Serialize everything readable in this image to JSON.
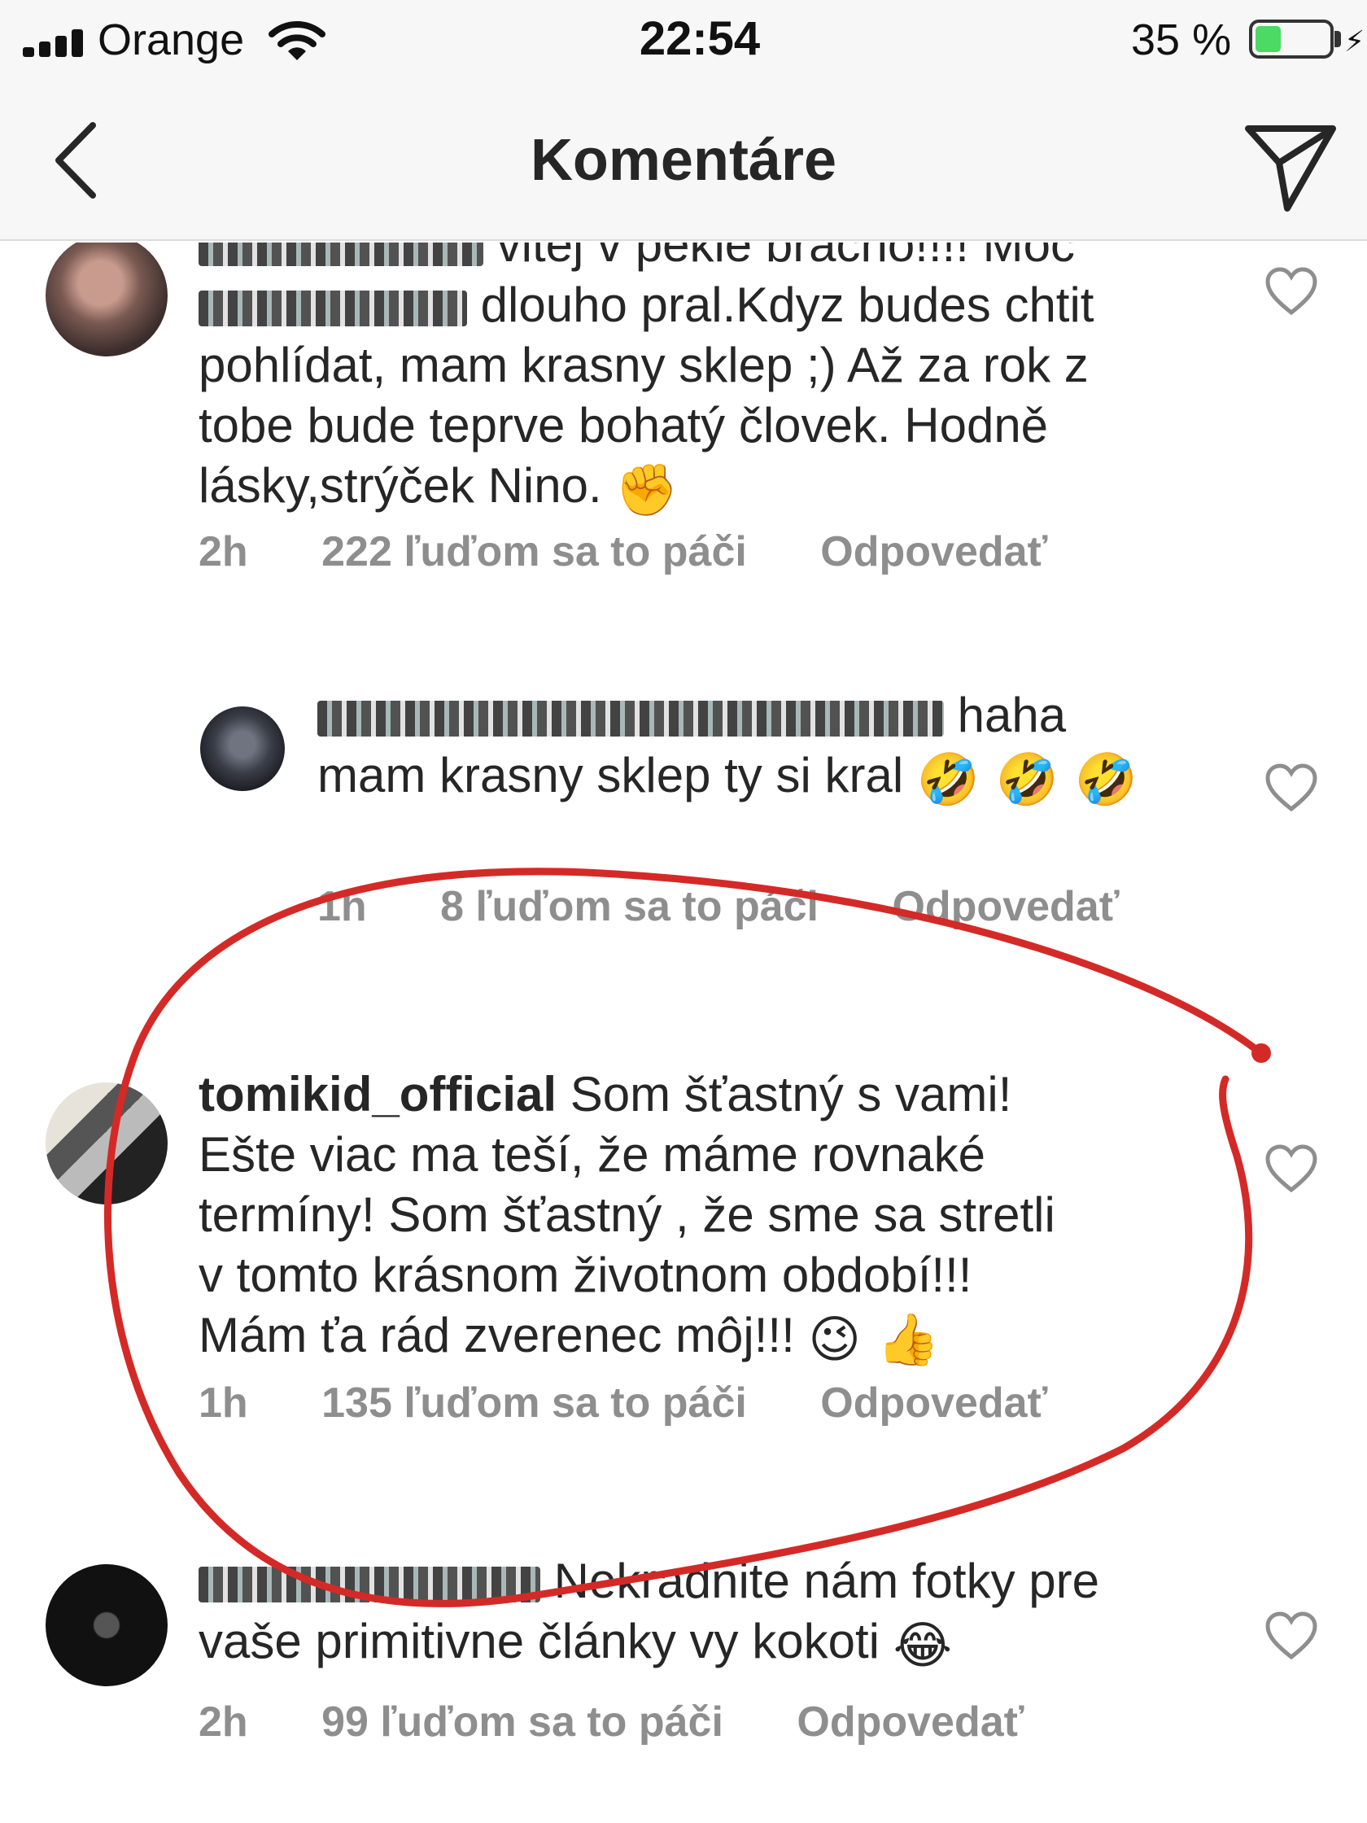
{
  "status_bar": {
    "carrier": "Orange",
    "time": "22:54",
    "battery_percent_label": "35 %",
    "battery_level": 0.35,
    "icons": [
      "signal-icon",
      "wifi-icon",
      "battery-icon",
      "charging-icon"
    ]
  },
  "nav": {
    "title": "Komentáre",
    "back_icon": "chevron-left-icon",
    "send_icon": "paper-plane-icon"
  },
  "comments": [
    {
      "user": "",
      "username_obscured": true,
      "text_lines": [
        "vitej v pekle bracho!!!! Moc",
        "dlouho pral.Kdyz budes chtit",
        "pohlídat, mam krasny sklep ;) Až za rok z",
        "tobe bude teprve bohatý človek. Hodně",
        "lásky,strýček Nino."
      ],
      "emoji": "✊",
      "time": "2h",
      "likes": "222 ľuďom sa to páči",
      "reply": "Odpovedať"
    },
    {
      "user": "",
      "username_obscured": true,
      "text_lines": [
        "haha",
        "mam krasny sklep ty si kral"
      ],
      "emoji": "🤣 🤣 🤣",
      "time": "1h",
      "likes": "8 ľuďom sa to páči",
      "reply": "Odpovedať"
    },
    {
      "user": "tomikid_official",
      "username_obscured": false,
      "text_lines": [
        "Som šťastný  s vami!",
        "Ešte  viac ma teší,  že  máme rovnaké",
        "termíny! Som šťastný , že  sme sa stretli",
        "v tomto krásnom  životnom  období!!!",
        "Mám ťa  rád  zverenec môj!!!"
      ],
      "emoji": "😉 👍",
      "time": "1h",
      "likes": "135 ľuďom sa to páči",
      "reply": "Odpovedať"
    },
    {
      "user": "",
      "username_obscured": true,
      "text_lines": [
        "Nekradnite nám fotky pre",
        "vaše primitivne články vy kokoti"
      ],
      "emoji": "😂",
      "time": "2h",
      "likes": "99 ľuďom sa to páči",
      "reply": "Odpovedať"
    }
  ],
  "colors": {
    "meta_gray": "#8e8e8e",
    "text": "#262626",
    "bar_bg": "#f7f7f7",
    "annotation_red": "#d42a27",
    "battery_green": "#4cd964"
  }
}
